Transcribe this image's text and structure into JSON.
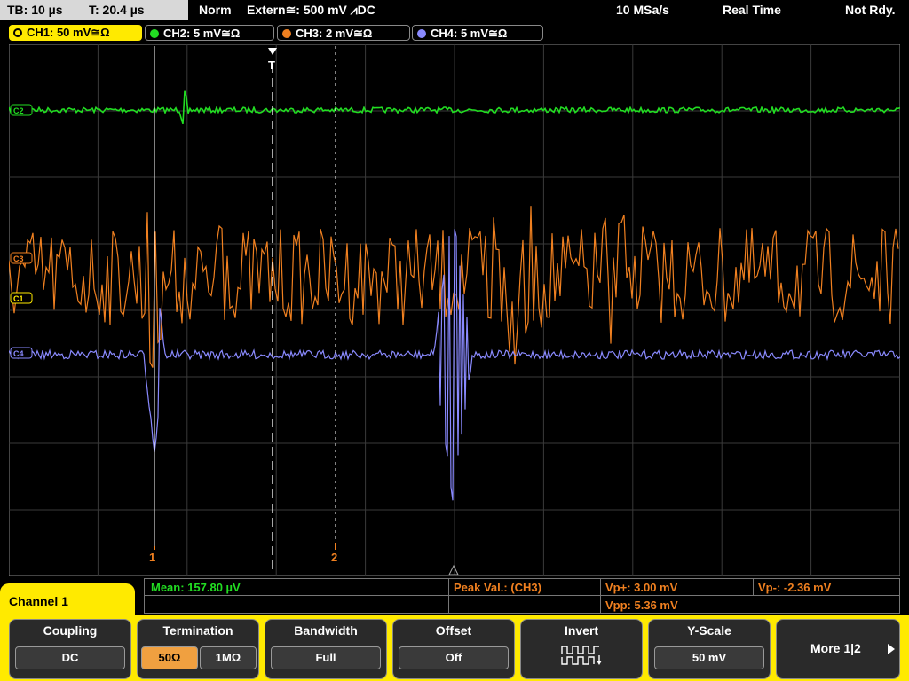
{
  "status_bar": {
    "timebase": "TB: 10 µs",
    "trigger_time": "T: 20.4 µs",
    "trigger_mode": "Norm",
    "trigger_source": "Extern≅: 500 mV ⩘DC",
    "sample_rate": "10 MSa/s",
    "acquisition_mode": "Real Time",
    "state": "Not Rdy."
  },
  "channels": [
    {
      "label": "CH1: 50 mV≅Ω",
      "color": "#ffea00",
      "active": true
    },
    {
      "label": "CH2: 5 mV≅Ω",
      "color": "#22dd22",
      "active": false
    },
    {
      "label": "CH3: 2 mV≅Ω",
      "color": "#f08020",
      "active": false
    },
    {
      "label": "CH4: 5 mV≅Ω",
      "color": "#8a8aff",
      "active": false
    }
  ],
  "cursors": {
    "c1": "1",
    "c2": "2"
  },
  "trigger_marker": "T",
  "channel_markers": {
    "ch1": "C1",
    "ch2": "C2",
    "ch3": "C3",
    "ch4": "C4"
  },
  "measurements": {
    "mean": "Mean: 157.80 µV",
    "peak": "Peak Val.:  (CH3)",
    "vp_plus": "Vp+: 3.00 mV",
    "vp_minus": "Vp-: -2.36 mV",
    "vpp": "Vpp: 5.36 mV"
  },
  "menu_title": "Channel 1",
  "softkeys": {
    "coupling": {
      "title": "Coupling",
      "value": "DC"
    },
    "termination": {
      "title": "Termination",
      "opt1": "50Ω",
      "opt2": "1MΩ"
    },
    "bandwidth": {
      "title": "Bandwidth",
      "value": "Full"
    },
    "offset": {
      "title": "Offset",
      "value": "Off"
    },
    "invert": {
      "title": "Invert"
    },
    "yscale": {
      "title": "Y-Scale",
      "value": "50 mV"
    },
    "more": {
      "title": "More 1|2"
    }
  }
}
